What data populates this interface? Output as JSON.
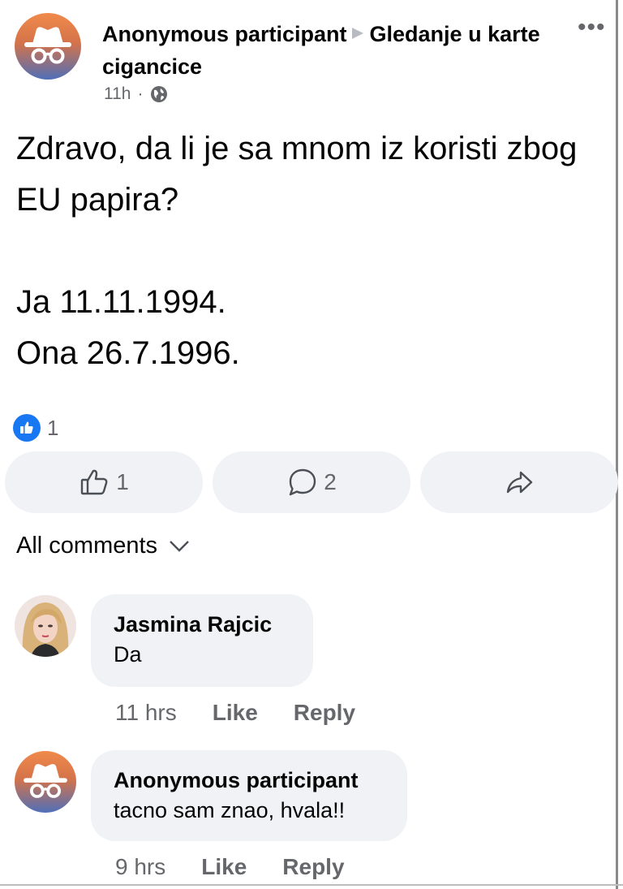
{
  "post": {
    "author": "Anonymous participant",
    "group": "Gledanje u karte cigancice",
    "time": "11h",
    "dot": "·",
    "more": "•••",
    "text": "Zdravo, da li je sa mnom iz koristi zbog EU papira?\n\nJa 11.11.1994.\nOna 26.7.1996.",
    "reaction_count": "1"
  },
  "actions": {
    "like_count": "1",
    "comment_count": "2"
  },
  "comments_header": {
    "label": "All comments"
  },
  "comments": [
    {
      "author": "Jasmina Rajcic",
      "text": "Da",
      "time": "11 hrs",
      "like_label": "Like",
      "reply_label": "Reply"
    },
    {
      "author": "Anonymous participant",
      "text": "tacno sam znao, hvala!!",
      "time": "9 hrs",
      "like_label": "Like",
      "reply_label": "Reply"
    }
  ],
  "icons": {
    "header_avatar": "anonymous-avatar-icon",
    "globe": "globe-icon",
    "like_badge": "like-reaction-icon",
    "like": "thumbs-up-icon",
    "comment": "comment-bubble-icon",
    "share": "share-arrow-icon",
    "chevron": "chevron-down-icon"
  },
  "colors": {
    "accent": "#1877f2",
    "secondary_text": "#65676b",
    "bubble_bg": "#f0f2f5"
  }
}
